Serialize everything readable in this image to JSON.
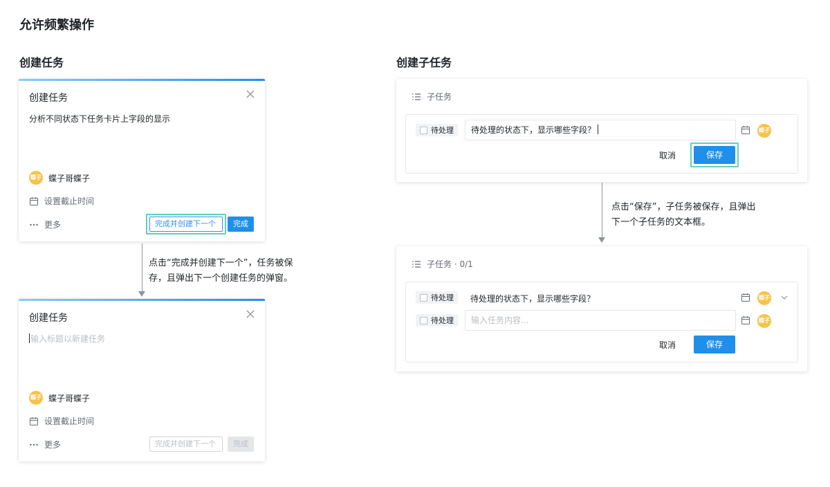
{
  "page_title": "允许频繁操作",
  "left": {
    "section_title": "创建任务",
    "dialog1": {
      "title": "创建任务",
      "content": "分析不同状态下任务卡片上字段的显示",
      "avatar_text": "蝶子",
      "assignee": "蝶子哥蝶子",
      "due_label": "设置截止时间",
      "more_label": "更多",
      "create_next_label": "完成并创建下一个",
      "done_label": "完成"
    },
    "note": [
      "点击“完成并创建下一个”，任务被保",
      "存，且弹出下一个创建任务的弹窗。"
    ],
    "dialog2": {
      "title": "创建任务",
      "placeholder": "输入标题以新建任务",
      "avatar_text": "蝶子",
      "assignee": "蝶子哥蝶子",
      "due_label": "设置截止时间",
      "more_label": "更多",
      "create_next_label": "完成并创建下一个",
      "done_label": "完成"
    }
  },
  "right": {
    "section_title": "创建子任务",
    "panel1": {
      "header": "子任务",
      "status": "待处理",
      "input_value": "待处理的状态下，显示哪些字段？",
      "avatar_text": "蝶子",
      "cancel_label": "取消",
      "save_label": "保存"
    },
    "note": [
      "点击“保存”，子任务被保存，且弹出",
      "下一个子任务的文本框。"
    ],
    "panel2": {
      "header": "子任务 · 0/1",
      "task_status": "待处理",
      "task_text": "待处理的状态下，显示哪些字段？",
      "avatar_text": "蝶子",
      "new_status": "待处理",
      "input_placeholder": "输入任务内容...",
      "cancel_label": "取消",
      "save_label": "保存"
    }
  },
  "colors": {
    "primary": "#1f8fea",
    "focus": "#5fd1b9",
    "avatar": "#f6c34a"
  }
}
